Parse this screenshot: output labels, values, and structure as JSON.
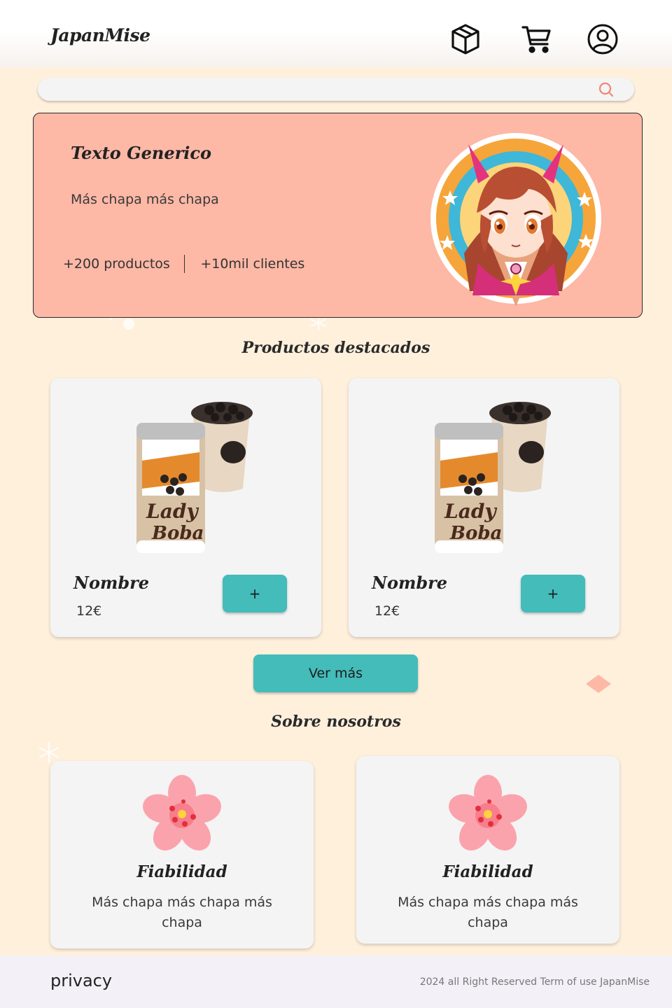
{
  "header": {
    "logo": "JapanMise",
    "icons": [
      "package-icon",
      "cart-icon",
      "user-icon"
    ]
  },
  "search": {
    "placeholder": "",
    "icon": "search-icon"
  },
  "hero": {
    "title": "Texto Generico",
    "text": "Más chapa más chapa",
    "stat_products": "+200 productos",
    "stat_clients": "+10mil clientes"
  },
  "featured": {
    "title": "Productos destacados",
    "products": [
      {
        "name": "Nombre",
        "price": "12€",
        "add_label": "+"
      },
      {
        "name": "Nombre",
        "price": "12€",
        "add_label": "+"
      }
    ],
    "more_label": "Ver más"
  },
  "about": {
    "title": "Sobre nosotros",
    "cards": [
      {
        "title": "Fiabilidad",
        "text": "Más chapa más chapa más chapa"
      },
      {
        "title": "Fiabilidad",
        "text": "Más chapa más chapa más chapa"
      }
    ]
  },
  "footer": {
    "privacy": "privacy",
    "copyright": "2024 all Right Reserved Term of use JapanMise"
  },
  "colors": {
    "page_bg": "#fff0dc",
    "hero_bg": "#fdb8a6",
    "accent": "#43bcba",
    "card_bg": "#f4f4f4",
    "footer_bg": "#f4f0f8"
  }
}
